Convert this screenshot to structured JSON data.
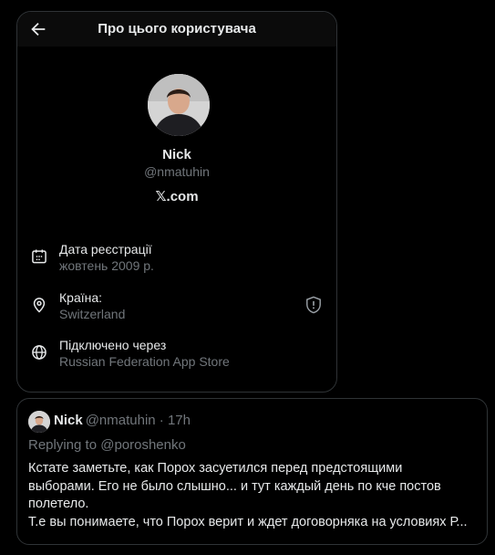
{
  "header": {
    "title": "Про цього користувача"
  },
  "profile": {
    "name": "Nick",
    "handle": "@nmatuhin",
    "site": "𝕏.com"
  },
  "info": [
    {
      "icon": "calendar-icon",
      "label": "Дата реєстрації",
      "value": "жовтень 2009 р."
    },
    {
      "icon": "location-pin-icon",
      "label": "Країна:",
      "value": "Switzerland"
    },
    {
      "icon": "globe-icon",
      "label": "Підключено через",
      "value": "Russian Federation App Store"
    }
  ],
  "tweet": {
    "name": "Nick",
    "handle_time": "@nmatuhin · 17h",
    "replying": "Replying to @poroshenko",
    "lines": [
      "Кстате заметьте, как Порох засуетился перед предстоящими",
      "выборами. Его не было слышно... и тут каждый день по кче постов",
      "полетело.",
      "Т.е вы понимаете, что Порох верит и ждет договорняка на условиях Р..."
    ]
  },
  "colors": {
    "background": "#000000",
    "border": "#2f3336",
    "muted": "#71767b",
    "text": "#e7e9ea"
  }
}
